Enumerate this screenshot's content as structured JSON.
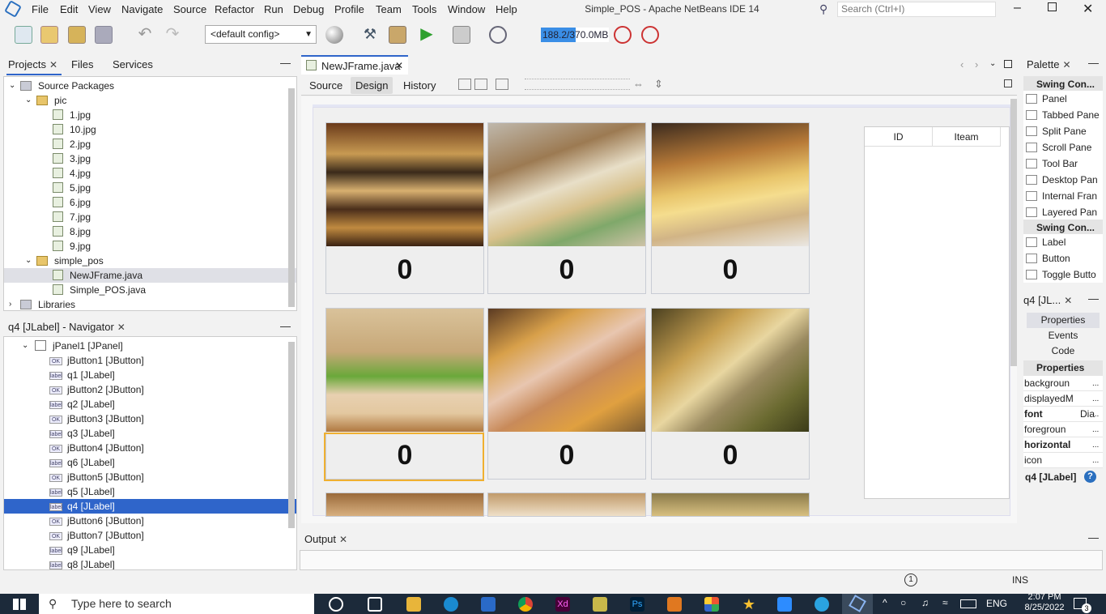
{
  "menu": [
    "File",
    "Edit",
    "View",
    "Navigate",
    "Source",
    "Refactor",
    "Run",
    "Debug",
    "Profile",
    "Team",
    "Tools",
    "Window",
    "Help"
  ],
  "window_title": "Simple_POS - Apache NetBeans IDE 14",
  "search": {
    "placeholder": "Search (Ctrl+I)"
  },
  "toolbar": {
    "config": "<default config>",
    "memory": "188.2/370.0MB",
    "memory_fraction": 0.51
  },
  "projects_tabs": {
    "projects": "Projects",
    "files": "Files",
    "services": "Services"
  },
  "projects_tree": [
    {
      "label": "Source Packages",
      "kind": "folder",
      "level": 1
    },
    {
      "label": "pic",
      "kind": "package",
      "level": 2
    },
    {
      "label": "1.jpg",
      "kind": "file",
      "level": 3
    },
    {
      "label": "10.jpg",
      "kind": "file",
      "level": 3
    },
    {
      "label": "2.jpg",
      "kind": "file",
      "level": 3
    },
    {
      "label": "3.jpg",
      "kind": "file",
      "level": 3
    },
    {
      "label": "4.jpg",
      "kind": "file",
      "level": 3
    },
    {
      "label": "5.jpg",
      "kind": "file",
      "level": 3
    },
    {
      "label": "6.jpg",
      "kind": "file",
      "level": 3
    },
    {
      "label": "7.jpg",
      "kind": "file",
      "level": 3
    },
    {
      "label": "8.jpg",
      "kind": "file",
      "level": 3
    },
    {
      "label": "9.jpg",
      "kind": "file",
      "level": 3
    },
    {
      "label": "simple_pos",
      "kind": "package",
      "level": 2
    },
    {
      "label": "NewJFrame.java",
      "kind": "java",
      "level": 3,
      "selected": true
    },
    {
      "label": "Simple_POS.java",
      "kind": "java",
      "level": 3
    },
    {
      "label": "Libraries",
      "kind": "folder",
      "level": 1
    }
  ],
  "navigator": {
    "title": "q4 [JLabel] - Navigator",
    "items": [
      {
        "label": "jPanel1 [JPanel]",
        "badge": "",
        "level": 1
      },
      {
        "label": "jButton1 [JButton]",
        "badge": "OK",
        "level": 2
      },
      {
        "label": "q1 [JLabel]",
        "badge": "label",
        "level": 2
      },
      {
        "label": "jButton2 [JButton]",
        "badge": "OK",
        "level": 2
      },
      {
        "label": "q2 [JLabel]",
        "badge": "label",
        "level": 2
      },
      {
        "label": "jButton3 [JButton]",
        "badge": "OK",
        "level": 2
      },
      {
        "label": "q3 [JLabel]",
        "badge": "label",
        "level": 2
      },
      {
        "label": "jButton4 [JButton]",
        "badge": "OK",
        "level": 2
      },
      {
        "label": "q6 [JLabel]",
        "badge": "label",
        "level": 2
      },
      {
        "label": "jButton5 [JButton]",
        "badge": "OK",
        "level": 2
      },
      {
        "label": "q5 [JLabel]",
        "badge": "label",
        "level": 2
      },
      {
        "label": "q4 [JLabel]",
        "badge": "label",
        "level": 2,
        "selected": true
      },
      {
        "label": "jButton6 [JButton]",
        "badge": "OK",
        "level": 2
      },
      {
        "label": "jButton7 [JButton]",
        "badge": "OK",
        "level": 2
      },
      {
        "label": "q9 [JLabel]",
        "badge": "label",
        "level": 2
      },
      {
        "label": "q8 [JLabel]",
        "badge": "label",
        "level": 2
      }
    ]
  },
  "editor": {
    "file_tab": "NewJFrame.java",
    "views": {
      "source": "Source",
      "design": "Design",
      "history": "History"
    },
    "cells": [
      "0",
      "0",
      "0",
      "0",
      "0",
      "0"
    ],
    "table_headers": [
      "ID",
      "Iteam"
    ]
  },
  "palette": {
    "title": "Palette",
    "group1": "Swing Con...",
    "items1": [
      "Panel",
      "Tabbed Pane",
      "Split Pane",
      "Scroll Pane",
      "Tool Bar",
      "Desktop Pan",
      "Internal Fran",
      "Layered Pan"
    ],
    "group2": "Swing Con...",
    "items2": [
      "Label",
      "Button",
      "Toggle Butto"
    ]
  },
  "properties": {
    "title": "q4 [JL...",
    "tabs": [
      "Properties",
      "Events",
      "Code"
    ],
    "section": "Properties",
    "rows": [
      {
        "name": "backgroun",
        "bold": false
      },
      {
        "name": "displayedM",
        "bold": false
      },
      {
        "name": "font",
        "bold": true,
        "value": "Dia"
      },
      {
        "name": "foregroun",
        "bold": false
      },
      {
        "name": "horizontal",
        "bold": true
      },
      {
        "name": "icon",
        "bold": false
      }
    ],
    "footer": "q4 [JLabel]"
  },
  "output": {
    "tab": "Output"
  },
  "status": {
    "mode": "INS",
    "notifications": "1"
  },
  "taskbar": {
    "search": "Type here to search",
    "time": "2:07 PM",
    "date": "8/25/2022",
    "lang": "ENG",
    "notif_count": "3"
  },
  "colors": {
    "accent": "#1e6ec8",
    "selection": "#2f65ca",
    "taskbar": "#1c2a3a"
  }
}
